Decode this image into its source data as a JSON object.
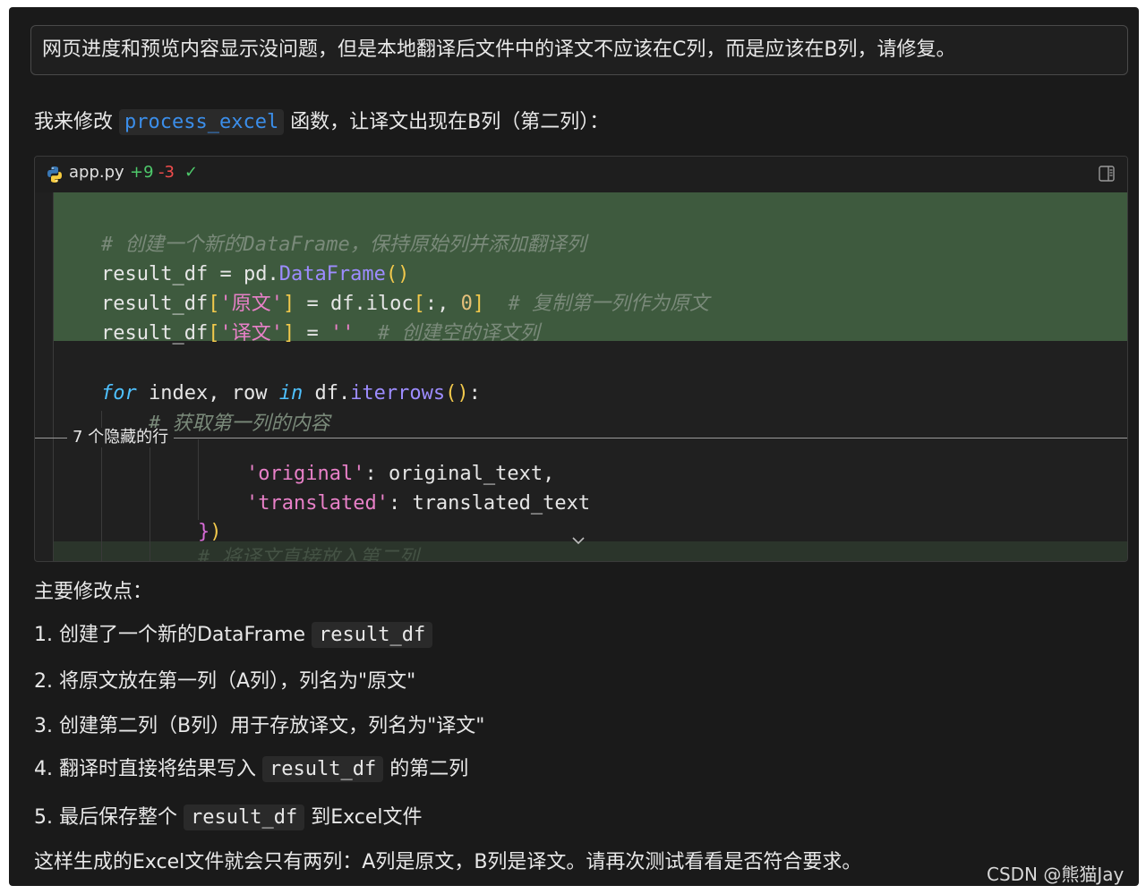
{
  "user_message": "网页进度和预览内容显示没问题，但是本地翻译后文件中的译文不应该在C列，而是应该在B列，请修复。",
  "intro": {
    "prefix": "我来修改 ",
    "code": "process_excel",
    "suffix": " 函数，让译文出现在B列（第二列）："
  },
  "code_block": {
    "filename": "app.py",
    "additions": "+9",
    "deletions": "-3",
    "status_icon": "checkmark-icon",
    "hidden_lines_label": "7 个隐藏的行",
    "lines": {
      "l1_comment": "# 创建一个新的DataFrame，保持原始列并添加翻译列",
      "l2_var": "result_df",
      "l2_eq": " = pd.",
      "l2_fn": "DataFrame",
      "l2_paren": "()",
      "l3_var": "result_df",
      "l3_open": "[",
      "l3_key": "'原文'",
      "l3_close": "]",
      "l3_mid": " = df.iloc",
      "l3_br_open": "[",
      "l3_args": ":, ",
      "l3_num": "0",
      "l3_br_close": "]",
      "l3_comment": "# 复制第一列作为原文",
      "l4_var": "result_df",
      "l4_open": "[",
      "l4_key": "'译文'",
      "l4_close": "]",
      "l4_eq": " = ",
      "l4_str": "''",
      "l4_comment": "# 创建空的译文列",
      "l5_for": "for",
      "l5_mid": " index, row ",
      "l5_in": "in",
      "l5_df": " df.",
      "l5_fn": "iterrows",
      "l5_paren": "()",
      "l5_colon": ":",
      "l6_comment": "# 获取第一列的内容",
      "l7_key": "'original'",
      "l7_rest": ": original_text,",
      "l8_key": "'translated'",
      "l8_rest": ": translated_text",
      "l9_brace": "}",
      "l9_paren": ")",
      "l10_comment": "# 将译文直接放入第二列"
    }
  },
  "summary_title": "主要修改点：",
  "points": [
    {
      "text": "1. 创建了一个新的DataFrame ",
      "code": "result_df",
      "after": ""
    },
    {
      "text": "2. 将原文放在第一列（A列），列名为\"原文\"",
      "code": "",
      "after": ""
    },
    {
      "text": "3. 创建第二列（B列）用于存放译文，列名为\"译文\"",
      "code": "",
      "after": ""
    },
    {
      "text": "4. 翻译时直接将结果写入 ",
      "code": "result_df",
      "after": " 的第二列"
    },
    {
      "text": "5. 最后保存整个 ",
      "code": "result_df",
      "after": " 到Excel文件"
    }
  ],
  "closing": "这样生成的Excel文件就会只有两列：A列是原文，B列是译文。请再次测试看看是否符合要求。",
  "watermark": "CSDN @熊猫Jay",
  "colors": {
    "background": "#1a1a1a",
    "diff_added": "#3e5a3e",
    "link_code": "#3b8eea",
    "additions": "#4ec96b",
    "deletions": "#f14c4c"
  }
}
